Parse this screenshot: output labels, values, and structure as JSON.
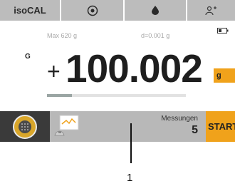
{
  "topbar": {
    "title": "isoCAL",
    "icons": [
      "level-icon",
      "drop-icon",
      "person-icon"
    ]
  },
  "info": {
    "max": "Max 620 g",
    "d": "d=0.001 g"
  },
  "display": {
    "indicator": "G",
    "sign": "+",
    "value": "100.002",
    "unit": "g",
    "capacity_used_fraction": 0.18
  },
  "bottombar": {
    "measurements_label": "Messungen",
    "measurements_value": "5",
    "start_label": "START"
  },
  "callout": {
    "number": "1"
  },
  "colors": {
    "accent": "#f0a21b",
    "bar_gray": "#b8b8b8",
    "menu_dark": "#3a3a3a"
  }
}
